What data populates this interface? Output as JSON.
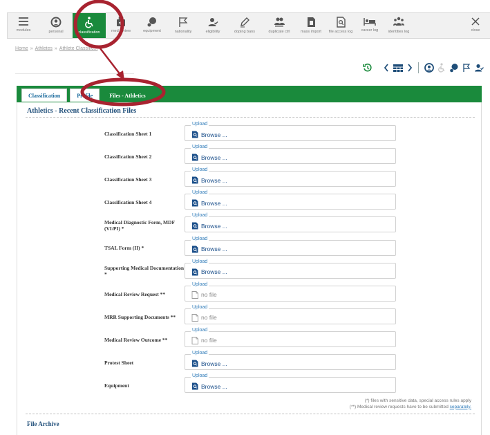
{
  "toolbar": {
    "items": [
      {
        "label": "modules",
        "icon": "menu-icon"
      },
      {
        "label": "personal",
        "icon": "person-icon"
      },
      {
        "label": "classification",
        "icon": "wheelchair-icon"
      },
      {
        "label": "med review",
        "icon": "medical-bag-icon"
      },
      {
        "label": "equipment",
        "icon": "equipment-icon"
      },
      {
        "label": "nationality",
        "icon": "flag-icon"
      },
      {
        "label": "eligibility",
        "icon": "user-check-icon"
      },
      {
        "label": "doping bans",
        "icon": "pen-icon"
      },
      {
        "label": "duplicate ctrl",
        "icon": "users-icon"
      },
      {
        "label": "mass import",
        "icon": "file-import-icon"
      },
      {
        "label": "file access log",
        "icon": "file-search-icon"
      },
      {
        "label": "career log",
        "icon": "bed-icon"
      },
      {
        "label": "identities log",
        "icon": "group-icon"
      }
    ],
    "close_label": "close",
    "active": "classification"
  },
  "breadcrumb": {
    "home": "Home",
    "sep": "»",
    "section": "Athletes",
    "current": "Athlete Classific..."
  },
  "tabs": [
    {
      "label": "Classification"
    },
    {
      "label": "Profile"
    },
    {
      "label": "Files - Athletics"
    }
  ],
  "section_title": "Athletics - Recent Classification Files",
  "upload_legend": "Upload",
  "files": [
    {
      "label": "Classification Sheet 1",
      "state": "browse",
      "value": "Browse ..."
    },
    {
      "label": "Classification Sheet 2",
      "state": "browse",
      "value": "Browse ..."
    },
    {
      "label": "Classification Sheet 3",
      "state": "browse",
      "value": "Browse ..."
    },
    {
      "label": "Classification Sheet 4",
      "state": "browse",
      "value": "Browse ..."
    },
    {
      "label": "Medical Diagnostic Form, MDF (VI/PI) *",
      "state": "browse",
      "value": "Browse ..."
    },
    {
      "label": "TSAL Form (II) *",
      "state": "browse",
      "value": "Browse ..."
    },
    {
      "label": "Supporting Medical Documentation *",
      "state": "browse",
      "value": "Browse ..."
    },
    {
      "label": "Medical Review Request **",
      "state": "nofile",
      "value": "no file"
    },
    {
      "label": "MRR Supporting Documents **",
      "state": "nofile",
      "value": "no file"
    },
    {
      "label": "Medical Review Outcome **",
      "state": "nofile",
      "value": "no file"
    },
    {
      "label": "Protest Sheet",
      "state": "browse",
      "value": "Browse ..."
    },
    {
      "label": "Equipment",
      "state": "browse",
      "value": "Browse ..."
    }
  ],
  "notes": {
    "line1": "(*) files with sensitive data, special access rules apply",
    "line2_prefix": "(**) Medical review requests have to be submitted",
    "line2_link": "separately."
  },
  "archive_title": "File Archive",
  "colors": {
    "accent_green": "#1a8a3c",
    "title_blue": "#1f4e79",
    "link_blue": "#2d7ab8",
    "annotation_red": "#a82330"
  }
}
